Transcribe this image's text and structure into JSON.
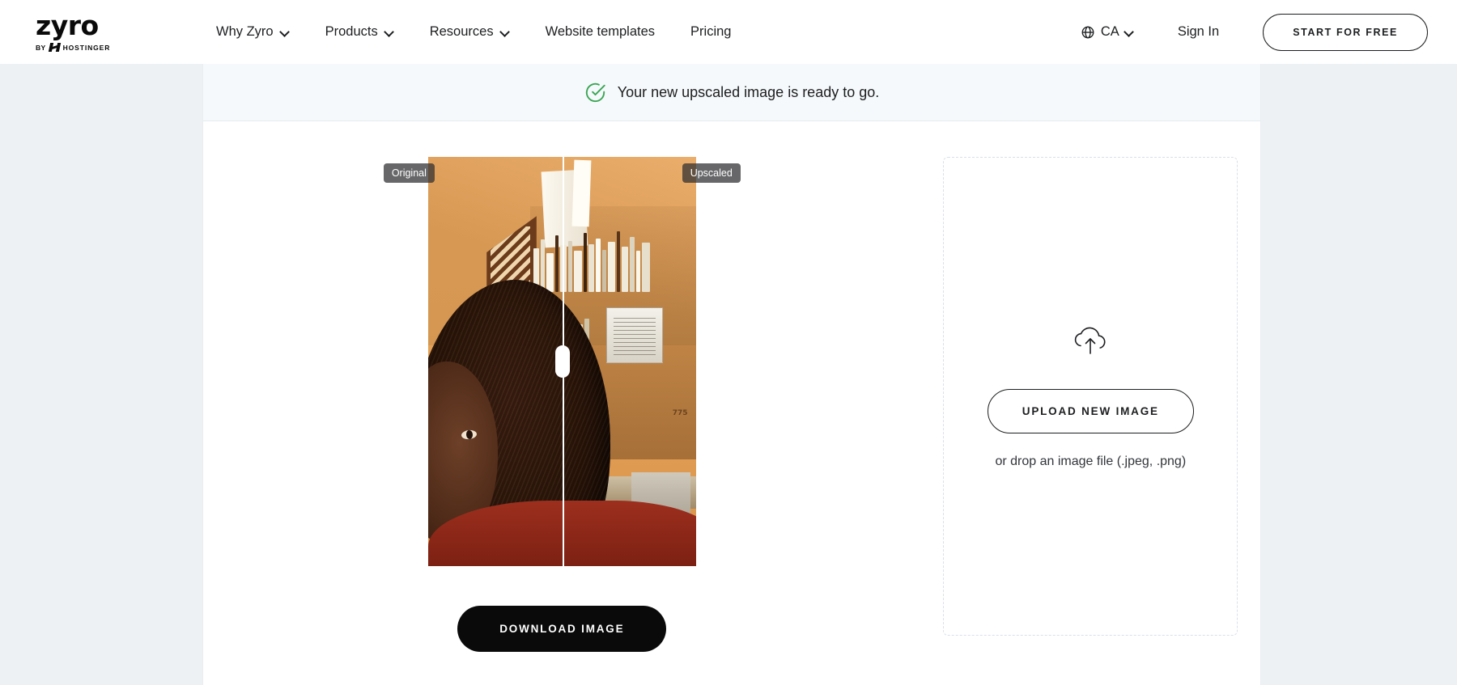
{
  "header": {
    "logo": {
      "word": "zyro",
      "by": "BY",
      "brand": "HOSTINGER",
      "icon": "hostinger-h-icon"
    },
    "nav": [
      {
        "label": "Why Zyro",
        "has_dropdown": true
      },
      {
        "label": "Products",
        "has_dropdown": true
      },
      {
        "label": "Resources",
        "has_dropdown": true
      },
      {
        "label": "Website templates",
        "has_dropdown": false
      },
      {
        "label": "Pricing",
        "has_dropdown": false
      }
    ],
    "locale": {
      "label": "CA",
      "icon": "globe-icon",
      "chevron": "chevron-down-icon"
    },
    "sign_in": "Sign In",
    "cta": "START FOR FREE"
  },
  "banner": {
    "icon": "check-circle-icon",
    "icon_color": "#3aa655",
    "text": "Your new upscaled image is ready to go."
  },
  "comparison": {
    "label_original": "Original",
    "label_upscaled": "Upscaled",
    "split_percent": 50,
    "handle": "compare-slider-handle",
    "photo_label_775": "775"
  },
  "actions": {
    "download": "DOWNLOAD IMAGE"
  },
  "upload": {
    "icon": "cloud-upload-icon",
    "button": "UPLOAD NEW IMAGE",
    "hint": "or drop an image file (.jpeg, .png)"
  },
  "colors": {
    "page_background": "#eef1f4",
    "card_background": "#ffffff",
    "banner_background": "#f6f9fb",
    "accent_dark": "#0a0a0a",
    "success_green": "#3aa655",
    "dashed_border": "#d9e0e6"
  }
}
